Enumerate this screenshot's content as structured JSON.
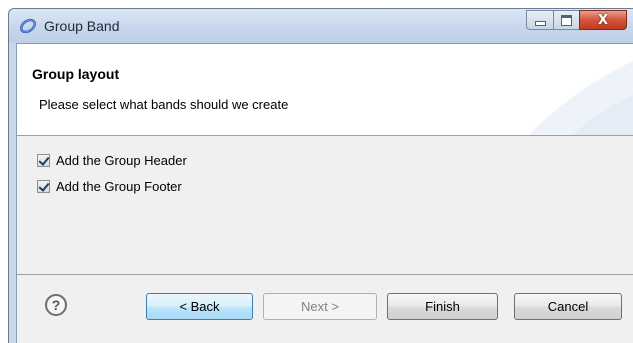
{
  "window": {
    "title": "Group Band",
    "controls": {
      "minimize": "minimize",
      "maximize": "maximize",
      "close": "X"
    }
  },
  "header": {
    "title": "Group layout",
    "description": "Please select what bands should we create"
  },
  "options": [
    {
      "label": "Add the Group Header",
      "checked": true
    },
    {
      "label": "Add the Group Footer",
      "checked": true
    }
  ],
  "footer": {
    "help_symbol": "?",
    "back_label": "< Back",
    "next_label": "Next >",
    "next_enabled": false,
    "finish_label": "Finish",
    "cancel_label": "Cancel"
  },
  "icons": {
    "app": "eclipse-birt-icon",
    "help": "help-icon"
  },
  "colors": {
    "titlebar": "#c6d7ec",
    "close_button": "#c2391f",
    "focused_button_border": "#3c7fb1"
  }
}
